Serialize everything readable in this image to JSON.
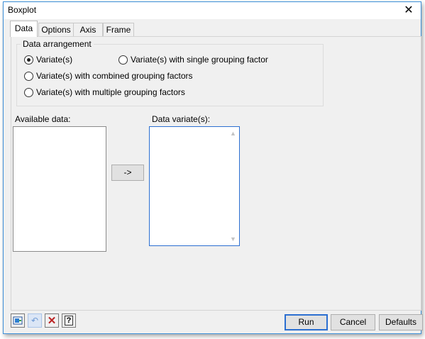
{
  "window": {
    "title": "Boxplot"
  },
  "tabs": [
    "Data",
    "Options",
    "Axis",
    "Frame"
  ],
  "data_arrangement": {
    "legend": "Data arrangement",
    "options": [
      {
        "label": "Variate(s)",
        "selected": true
      },
      {
        "label": "Variate(s) with single grouping factor",
        "selected": false
      },
      {
        "label": "Variate(s) with combined grouping factors",
        "selected": false
      },
      {
        "label": "Variate(s) with multiple grouping factors",
        "selected": false
      }
    ]
  },
  "available_data": {
    "label": "Available data:"
  },
  "data_variates": {
    "label": "Data variate(s):"
  },
  "transfer_button": "->",
  "footer": {
    "run": "Run",
    "cancel": "Cancel",
    "defaults": "Defaults",
    "icons": [
      "pin-icon",
      "undo-icon",
      "clear-icon",
      "help-icon"
    ]
  }
}
